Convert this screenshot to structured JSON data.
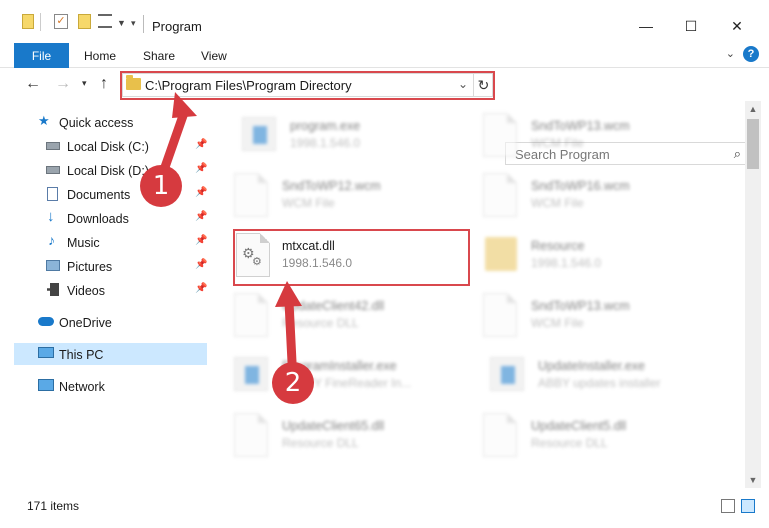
{
  "window": {
    "title": "Program",
    "controls": {
      "minimize": "—",
      "maximize": "☐",
      "close": "✕"
    }
  },
  "ribbon": {
    "file_tab": "File",
    "tabs": [
      "Home",
      "Share",
      "View"
    ],
    "help": "?"
  },
  "address": {
    "path": "C:\\Program Files\\Program Directory",
    "refresh_icon": "refresh-icon"
  },
  "search": {
    "placeholder": "Search Program"
  },
  "sidebar": {
    "items": [
      {
        "label": "Quick access",
        "icon": "star-icon"
      },
      {
        "label": "Local Disk (C:)",
        "icon": "drive-icon",
        "pinned": true
      },
      {
        "label": "Local Disk (D:)",
        "icon": "drive-icon",
        "pinned": true
      },
      {
        "label": "Documents",
        "icon": "documents-icon",
        "pinned": true
      },
      {
        "label": "Downloads",
        "icon": "downloads-icon",
        "pinned": true
      },
      {
        "label": "Music",
        "icon": "music-icon",
        "pinned": true
      },
      {
        "label": "Pictures",
        "icon": "pictures-icon",
        "pinned": true
      },
      {
        "label": "Videos",
        "icon": "videos-icon",
        "pinned": true
      },
      {
        "label": "OneDrive",
        "icon": "cloud-icon"
      },
      {
        "label": "This PC",
        "icon": "pc-icon",
        "selected": true
      },
      {
        "label": "Network",
        "icon": "network-icon"
      }
    ]
  },
  "files": [
    {
      "name": "program.exe",
      "meta": "1998.1.546.0",
      "type": "exe",
      "blurred": true
    },
    {
      "name": "SndToWP13.wcm",
      "meta": "WCM File",
      "type": "doc",
      "blurred": true
    },
    {
      "name": "SndToWP12.wcm",
      "meta": "WCM File",
      "type": "doc",
      "blurred": true
    },
    {
      "name": "SndToWP16.wcm",
      "meta": "WCM File",
      "type": "doc",
      "blurred": true
    },
    {
      "name": "mtxcat.dll",
      "meta": "1998.1.546.0",
      "type": "dll",
      "blurred": false
    },
    {
      "name": "Resource",
      "meta": "1998.1.546.0",
      "type": "folder",
      "blurred": true
    },
    {
      "name": "UpdateClient42.dll",
      "meta": "Resource DLL",
      "type": "dll",
      "blurred": true
    },
    {
      "name": "SndToWP13.wcm",
      "meta": "WCM File",
      "type": "doc",
      "blurred": true
    },
    {
      "name": "ProgramInstaller.exe",
      "meta": "ABBYY FineReader In...",
      "type": "app",
      "blurred": true
    },
    {
      "name": "UpdateInstaller.exe",
      "meta": "ABBY updates installer",
      "type": "app",
      "blurred": true
    },
    {
      "name": "UpdateClient65.dll",
      "meta": "Resource DLL",
      "type": "dll",
      "blurred": true
    },
    {
      "name": "UpdateClient5.dll",
      "meta": "Resource DLL",
      "type": "dll",
      "blurred": true
    }
  ],
  "status": {
    "item_count": "171 items"
  },
  "callouts": [
    "1",
    "2"
  ],
  "colors": {
    "accent": "#1979ca",
    "highlight": "#d9484d",
    "selected": "#cce8ff",
    "callout": "#d63a3f"
  }
}
